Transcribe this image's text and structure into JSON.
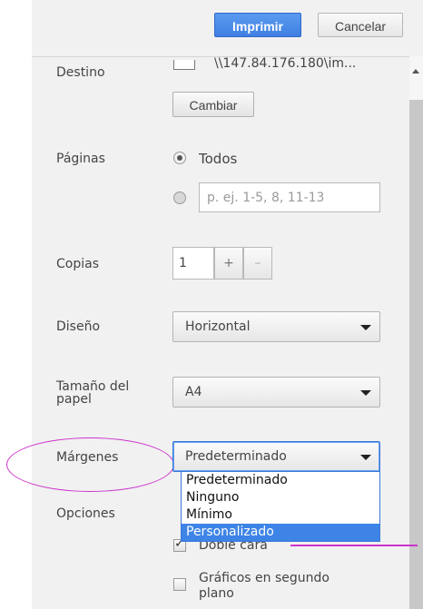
{
  "header": {
    "print_label": "Imprimir",
    "cancel_label": "Cancelar"
  },
  "destination": {
    "label": "Destino",
    "value": "\\\\147.84.176.180\\im...",
    "change_label": "Cambiar"
  },
  "pages": {
    "label": "Páginas",
    "all_label": "Todos",
    "range_placeholder": "p. ej. 1-5, 8, 11-13",
    "selected": "all"
  },
  "copies": {
    "label": "Copias",
    "value": "1",
    "plus_label": "+",
    "minus_label": "–"
  },
  "layout": {
    "label": "Diseño",
    "value": "Horizontal"
  },
  "paper_size": {
    "label_line1": "Tamaño del",
    "label_line2": "papel",
    "value": "A4"
  },
  "margins": {
    "label": "Márgenes",
    "value": "Predeterminado",
    "options": [
      "Predeterminado",
      "Ninguno",
      "Mínimo",
      "Personalizado"
    ],
    "highlighted_index": 3
  },
  "options": {
    "label": "Opciones",
    "duplex_label": "Doble cara",
    "duplex_checked": true,
    "background_label_line1": "Gráficos en segundo",
    "background_label_line2": "plano",
    "background_checked": false
  },
  "colors": {
    "primary": "#3f7fe3",
    "annotation": "#cc33cc",
    "highlight": "#3d84e6"
  }
}
